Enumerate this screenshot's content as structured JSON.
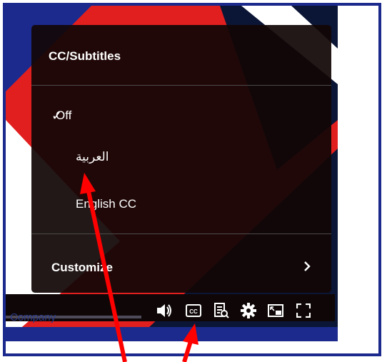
{
  "menu": {
    "title": "CC/Subtitles",
    "options": [
      {
        "label": "Off",
        "selected": true
      },
      {
        "label": "العربية",
        "selected": false
      },
      {
        "label": "English CC",
        "selected": false
      }
    ],
    "customize_label": "Customize"
  },
  "player": {
    "progress_label": "Company"
  },
  "colors": {
    "frame_border": "#1b2a8c",
    "annotation_arrow": "#ff0000",
    "video_accent": "#e21f1f"
  },
  "icons": [
    "check-icon",
    "chevron-right-icon",
    "volume-icon",
    "cc-icon",
    "transcript-icon",
    "settings-icon",
    "picture-in-picture-icon",
    "fullscreen-icon"
  ]
}
